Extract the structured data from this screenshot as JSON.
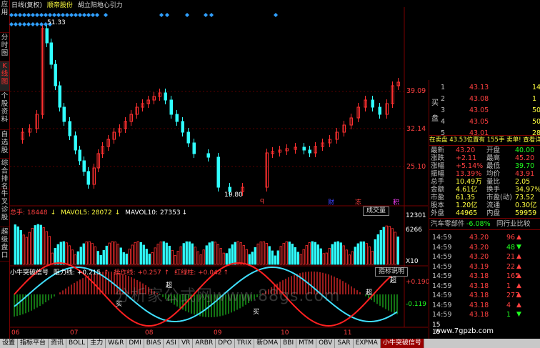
{
  "header": {
    "mode": "日线(复权)",
    "stock": "顺帝股份",
    "indicator": "胡立阳地心引力"
  },
  "left_nav": [
    {
      "label": "应用",
      "active": false
    },
    {
      "label": "分时图",
      "active": false
    },
    {
      "label": "K线图",
      "active": true
    },
    {
      "label": "个股资料",
      "active": false
    },
    {
      "label": "自选股",
      "active": false
    },
    {
      "label": "综合排名",
      "active": false
    },
    {
      "label": "牛叉诊股",
      "active": false
    },
    {
      "label": "超级盘口",
      "active": false
    }
  ],
  "price_chart": {
    "high_label": "51.33",
    "low_label": "19.80",
    "axis_labels": [
      "39.09",
      "32.14",
      "25.10"
    ],
    "event_marks": [
      "q",
      "财",
      "冻",
      "积"
    ]
  },
  "volume_panel": {
    "total_label": "总手",
    "total": "18448",
    "ma5_label": "MAVOL5",
    "ma5": "28072",
    "ma10_label": "MAVOL10",
    "ma10": "27353",
    "axis_labels": [
      "12301",
      "6266",
      "X10"
    ],
    "button": "成交量"
  },
  "indicator_panel": {
    "name": "小牛突破信号",
    "resist_label": "阻力线",
    "resist": "+0.215",
    "op_label": "操作线",
    "op": "+0.257",
    "red_label": "红绿柱",
    "red": "+0.042",
    "button": "指标说明",
    "axis_labels": [
      "+0.190",
      "-0.119"
    ],
    "marks": [
      "买",
      "超",
      "买",
      "超",
      "超"
    ]
  },
  "x_axis": [
    "06",
    "07",
    "08",
    "09",
    "10",
    "11"
  ],
  "bottom_tabs": [
    "设置",
    "指标平台",
    "资讯",
    "BOLL",
    "主力",
    "W&R",
    "DMI",
    "BIAS",
    "ASI",
    "VR",
    "ARBR",
    "DPO",
    "TRIX",
    "新DMA",
    "BBI",
    "MTM",
    "OBV",
    "SAR",
    "EXPMA",
    "小牛突破信号"
  ],
  "right_panel": {
    "buy_label": "买盘",
    "buy": [
      {
        "n": "1",
        "price": "43.13",
        "vol": "14"
      },
      {
        "n": "2",
        "price": "43.08",
        "vol": "1"
      },
      {
        "n": "3",
        "price": "43.05",
        "vol": "50"
      },
      {
        "n": "4",
        "price": "43.05",
        "vol": "50"
      },
      {
        "n": "5",
        "price": "43.01",
        "vol": "28"
      }
    ],
    "info_line": "在卖盘 43.53位置有 155手 卖单! 查看详细",
    "stats": [
      {
        "l1": "最新",
        "v1": "43.20",
        "l2": "开盘",
        "v2": "40.00"
      },
      {
        "l1": "涨跌",
        "v1": "+2.11",
        "l2": "最高",
        "v2": "45.20"
      },
      {
        "l1": "涨幅",
        "v1": "+5.14%",
        "l2": "最低",
        "v2": "39.70"
      },
      {
        "l1": "振幅",
        "v1": "13.39%",
        "l2": "均价",
        "v2": "43.91"
      },
      {
        "l1": "总手",
        "v1": "10.49万",
        "l2": "量比",
        "v2": "2.05"
      },
      {
        "l1": "金额",
        "v1": "4.61亿",
        "l2": "换手",
        "v2": "34.97%"
      },
      {
        "l1": "市盈",
        "v1": "61.35",
        "l2": "市盈(动)",
        "v2": "73.52"
      },
      {
        "l1": "股本",
        "v1": "1.20亿",
        "l2": "流通",
        "v2": "0.30亿"
      },
      {
        "l1": "外盘",
        "v1": "44965",
        "l2": "内盘",
        "v2": "59959"
      }
    ],
    "sector": "汽车零部件",
    "sector_change": "-6.08%",
    "compare_btn": "同行业比较",
    "ticks": [
      {
        "time": "14:59",
        "price": "43.20",
        "vol": "96",
        "dir": "up"
      },
      {
        "time": "14:59",
        "price": "43.20",
        "vol": "48",
        "dir": "down"
      },
      {
        "time": "14:59",
        "price": "43.20",
        "vol": "21",
        "dir": "up"
      },
      {
        "time": "14:59",
        "price": "43.19",
        "vol": "22",
        "dir": "up"
      },
      {
        "time": "14:59",
        "price": "43.18",
        "vol": "165",
        "dir": "up"
      },
      {
        "time": "14:59",
        "price": "43.18",
        "vol": "1",
        "dir": "up"
      },
      {
        "time": "14:59",
        "price": "43.18",
        "vol": "277",
        "dir": "up"
      },
      {
        "time": "14:59",
        "price": "43.18",
        "vol": "4",
        "dir": "up"
      },
      {
        "time": "14:59",
        "price": "43.18",
        "vol": "1",
        "dir": "down"
      }
    ],
    "footer_marks": [
      "15",
      "15"
    ]
  },
  "watermarks": {
    "site": "www.7gpzb.com",
    "center": "分析家公式网www.88gs.com"
  }
}
